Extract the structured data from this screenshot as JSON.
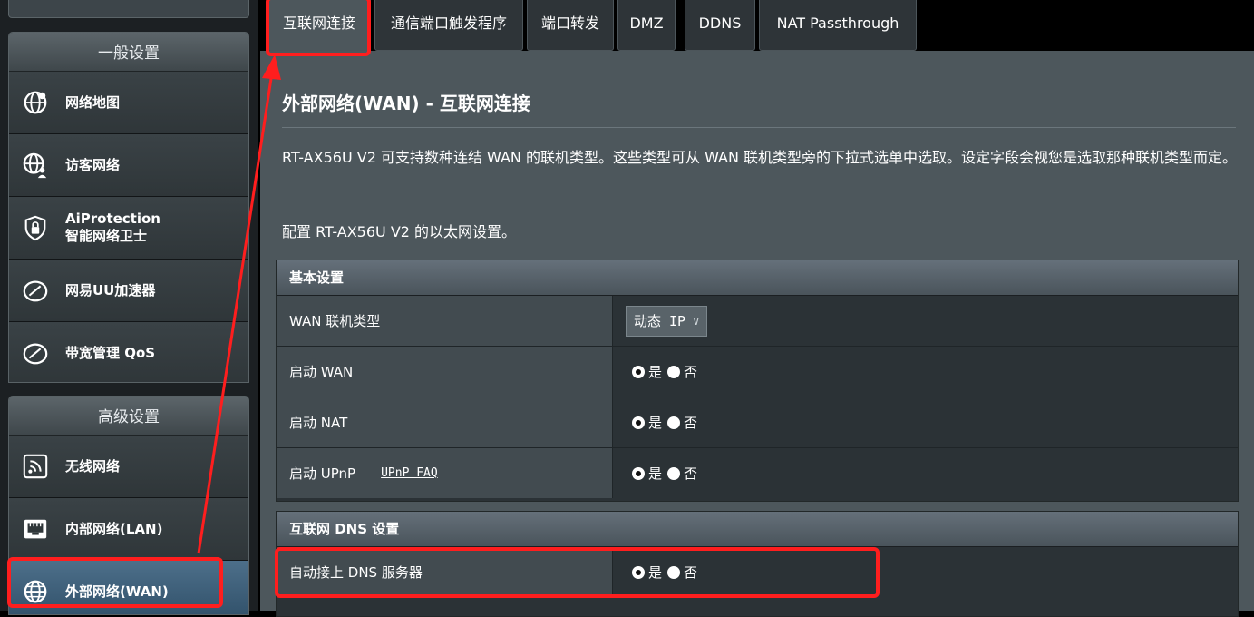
{
  "sidebar": {
    "general_header": "一般设置",
    "general_items": [
      {
        "label": "网络地图",
        "icon": "globe-network-icon"
      },
      {
        "label": "访客网络",
        "icon": "guest-network-icon"
      },
      {
        "label": "AiProtection",
        "sub": "智能网络卫士",
        "icon": "shield-lock-icon"
      },
      {
        "label": "网易UU加速器",
        "icon": "speedometer-icon"
      },
      {
        "label": "带宽管理 QoS",
        "icon": "qos-gauge-icon"
      }
    ],
    "advanced_header": "高级设置",
    "advanced_items": [
      {
        "label": "无线网络",
        "icon": "wifi-icon"
      },
      {
        "label": "内部网络(LAN)",
        "icon": "lan-port-icon"
      },
      {
        "label": "外部网络(WAN)",
        "icon": "globe-wan-icon",
        "active": true
      }
    ]
  },
  "tabs": [
    {
      "label": "互联网连接",
      "active": true
    },
    {
      "label": "通信端口触发程序"
    },
    {
      "label": "端口转发"
    },
    {
      "label": "DMZ"
    },
    {
      "label": "DDNS"
    },
    {
      "label": "NAT Passthrough"
    }
  ],
  "main": {
    "title": "外部网络(WAN) - 互联网连接",
    "description": "RT-AX56U V2 可支持数种连结 WAN 的联机类型。这些类型可从 WAN 联机类型旁的下拉式选单中选取。设定字段会视您是选取那种联机类型而定。",
    "config_line": "配置 RT-AX56U V2 的以太网设置。",
    "basic": {
      "header": "基本设置",
      "wan_type_label": "WAN 联机类型",
      "wan_type_value": "动态 IP",
      "enable_wan_label": "启动 WAN",
      "enable_nat_label": "启动 NAT",
      "enable_upnp_label": "启动 UPnP",
      "upnp_faq": "UPnP FAQ"
    },
    "dns": {
      "header": "互联网 DNS 设置",
      "auto_dns_label": "自动接上 DNS 服务器"
    },
    "yes": "是",
    "no": "否"
  },
  "colors": {
    "highlight": "#ff1e1e",
    "panel": "#4d575c",
    "active_nav": "#3f6482"
  }
}
